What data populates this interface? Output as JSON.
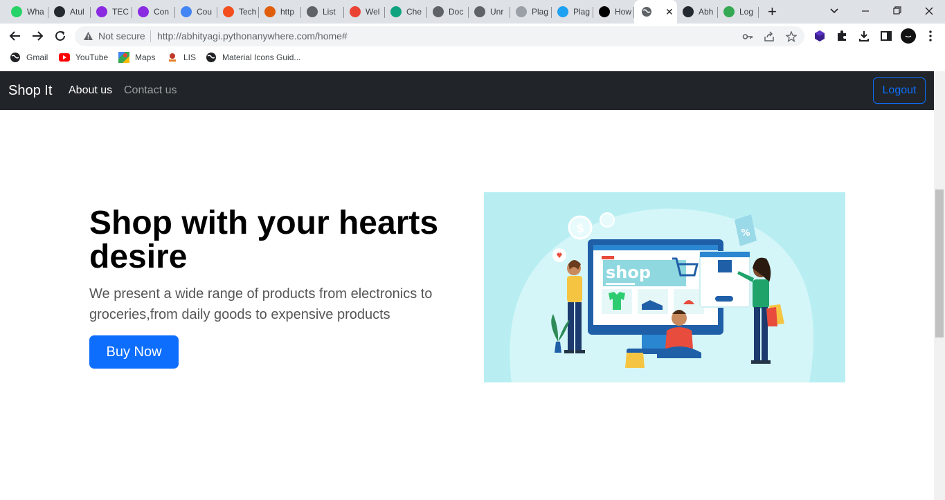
{
  "browser": {
    "tabs": [
      {
        "label": "Wha",
        "icon": "whatsapp-icon",
        "color": "#25d366"
      },
      {
        "label": "Atul",
        "icon": "github-icon",
        "color": "#24292f"
      },
      {
        "label": "TEC",
        "icon": "unstop-icon",
        "color": "#8a2be2"
      },
      {
        "label": "Con",
        "icon": "unstop-icon",
        "color": "#8a2be2"
      },
      {
        "label": "Cou",
        "icon": "google-docs-icon",
        "color": "#4285f4"
      },
      {
        "label": "Tech",
        "icon": "figma-icon",
        "color": "#f24e1e"
      },
      {
        "label": "http",
        "icon": "fn-icon",
        "color": "#e05d0b"
      },
      {
        "label": "List",
        "icon": "globe-icon",
        "color": "#5f6368"
      },
      {
        "label": "Wel",
        "icon": "bookmark-red-icon",
        "color": "#ea4335"
      },
      {
        "label": "Che",
        "icon": "chatgpt-icon",
        "color": "#10a37f"
      },
      {
        "label": "Doc",
        "icon": "search-doc-icon",
        "color": "#5f6368"
      },
      {
        "label": "Unr",
        "icon": "search-doc-icon",
        "color": "#5f6368"
      },
      {
        "label": "Plag",
        "icon": "sst-icon",
        "color": "#9aa0a6"
      },
      {
        "label": "Plag",
        "icon": "copyleaks-icon",
        "color": "#1da1f2"
      },
      {
        "label": "How",
        "icon": "medium-icon",
        "color": "#000000"
      }
    ],
    "active_tab_icon": "globe-icon",
    "tabs_after": [
      {
        "label": "Abh",
        "icon": "github-icon",
        "color": "#24292f"
      },
      {
        "label": "Log",
        "icon": "infinity-icon",
        "color": "#34a853"
      }
    ],
    "not_secure": "Not secure",
    "url": "http://abhityagi.pythonanywhere.com/home#",
    "bookmarks": [
      {
        "label": "Gmail",
        "icon": "globe-icon"
      },
      {
        "label": "YouTube",
        "icon": "youtube-icon"
      },
      {
        "label": "Maps",
        "icon": "maps-icon"
      },
      {
        "label": "LIS",
        "icon": "lis-icon"
      },
      {
        "label": "Material Icons Guid...",
        "icon": "globe-icon"
      }
    ]
  },
  "site": {
    "brand": "Shop It",
    "nav": {
      "about": "About us",
      "contact": "Contact us"
    },
    "logout": "Logout",
    "hero": {
      "title": "Shop with your hearts desire",
      "lead": "We present a wide range of products from electronics to groceries,from daily goods to expensive products",
      "cta": "Buy Now",
      "image_word": "shop"
    }
  },
  "colors": {
    "navbar": "#212529",
    "primary": "#0d6efd",
    "illustration_bg": "#b8eef2"
  }
}
